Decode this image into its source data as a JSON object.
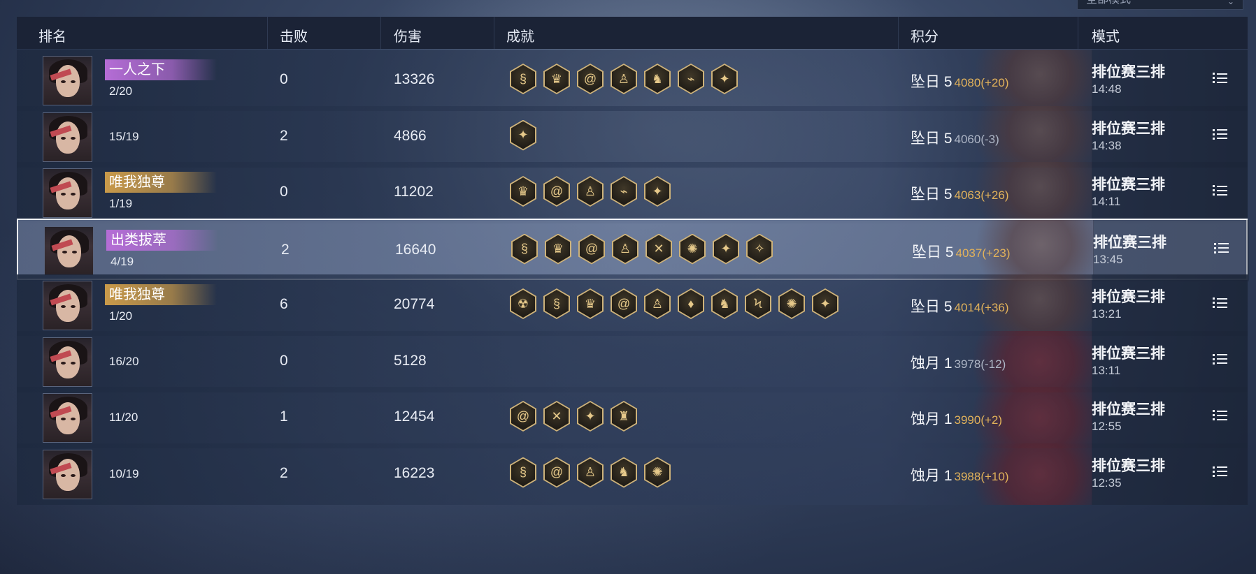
{
  "filter": {
    "label": "全部模式",
    "caret": "⌄"
  },
  "headers": {
    "rank": "排名",
    "kills": "击败",
    "damage": "伤害",
    "achievements": "成就",
    "score": "积分",
    "mode": "模式"
  },
  "colors": {
    "score_up": "#e2b25a",
    "score_down": "#aeb6c6",
    "title_purple": "#b56dd6",
    "title_gold": "#c99a4a",
    "selected_border": "#f2f4f8"
  },
  "rows": [
    {
      "title": "一人之下",
      "title_color": "purple",
      "record": "2/20",
      "kills": "0",
      "damage": "13326",
      "badges": [
        "lotus-serpent",
        "flame-crown",
        "swirl",
        "warrior",
        "rider",
        "boot",
        "winged-orb"
      ],
      "tier": "坠日 5",
      "score": "4080(+20)",
      "score_dir": "up",
      "mode": "排位赛三排",
      "time": "14:48",
      "selected": false
    },
    {
      "title": "",
      "title_color": "",
      "record": "15/19",
      "kills": "2",
      "damage": "4866",
      "badges": [
        "winged-orb"
      ],
      "tier": "坠日 5",
      "score": "4060(-3)",
      "score_dir": "down",
      "mode": "排位赛三排",
      "time": "14:38",
      "selected": false
    },
    {
      "title": "唯我独尊",
      "title_color": "gold",
      "record": "1/19",
      "kills": "0",
      "damage": "11202",
      "badges": [
        "flame-crown",
        "swirl",
        "warrior",
        "boot",
        "winged-orb"
      ],
      "tier": "坠日 5",
      "score": "4063(+26)",
      "score_dir": "up",
      "mode": "排位赛三排",
      "time": "14:11",
      "selected": false
    },
    {
      "title": "出类拔萃",
      "title_color": "purple",
      "record": "4/19",
      "kills": "2",
      "damage": "16640",
      "badges": [
        "lotus-serpent",
        "flame-crown",
        "swirl",
        "warrior",
        "cross-blades",
        "sun-burst",
        "winged-orb",
        "star-shard"
      ],
      "tier": "坠日 5",
      "score": "4037(+23)",
      "score_dir": "up",
      "mode": "排位赛三排",
      "time": "13:45",
      "selected": true
    },
    {
      "title": "唯我独尊",
      "title_color": "gold",
      "record": "1/20",
      "kills": "6",
      "damage": "20774",
      "badges": [
        "demon-mask",
        "lotus-serpent",
        "flame-crown",
        "swirl",
        "warrior",
        "tri-gem",
        "rider",
        "dragon",
        "sun-burst",
        "winged-orb"
      ],
      "tier": "坠日 5",
      "score": "4014(+36)",
      "score_dir": "up",
      "mode": "排位赛三排",
      "time": "13:21",
      "selected": false
    },
    {
      "title": "",
      "title_color": "",
      "record": "16/20",
      "kills": "0",
      "damage": "5128",
      "badges": [],
      "tier": "蚀月 1",
      "score": "3978(-12)",
      "score_dir": "down",
      "mode": "排位赛三排",
      "time": "13:11",
      "selected": false
    },
    {
      "title": "",
      "title_color": "",
      "record": "11/20",
      "kills": "1",
      "damage": "12454",
      "badges": [
        "swirl",
        "cross-blades",
        "winged-orb",
        "castle"
      ],
      "tier": "蚀月 1",
      "score": "3990(+2)",
      "score_dir": "up",
      "mode": "排位赛三排",
      "time": "12:55",
      "selected": false
    },
    {
      "title": "",
      "title_color": "",
      "record": "10/19",
      "kills": "2",
      "damage": "16223",
      "badges": [
        "lotus-serpent",
        "swirl",
        "warrior",
        "rider",
        "sun-burst"
      ],
      "tier": "蚀月 1",
      "score": "3988(+10)",
      "score_dir": "up",
      "mode": "排位赛三排",
      "time": "12:35",
      "selected": false
    }
  ]
}
